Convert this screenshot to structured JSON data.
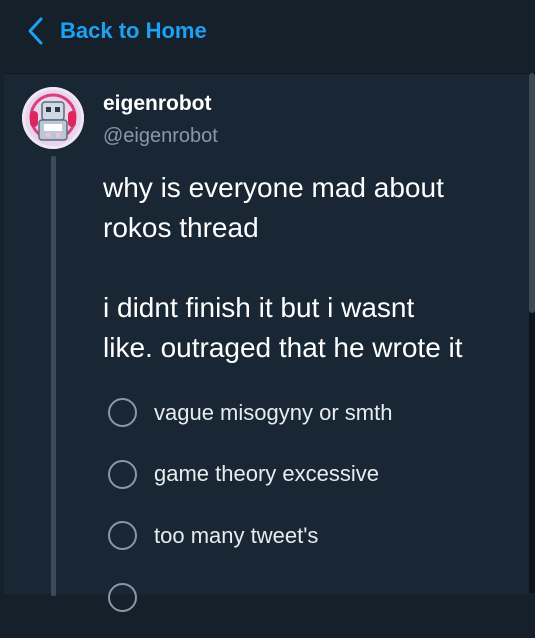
{
  "header": {
    "back_label": "Back to Home",
    "accent_color": "#1da1f2"
  },
  "tweet": {
    "display_name": "eigenrobot",
    "handle": "@eigenrobot",
    "text_lines": [
      "why is everyone mad about",
      "rokos thread",
      "i didnt finish it but i wasnt",
      "like. outraged that he wrote it"
    ],
    "poll": {
      "options": [
        "vague misogyny or smth",
        "game theory excessive",
        "too many tweet's",
        ""
      ]
    }
  },
  "icons": {
    "back": "chevron-left-icon",
    "avatar": "robot-avatar-image"
  },
  "theme": {
    "background": "#15202b",
    "panel": "#192734",
    "secondary_text": "#8899a6"
  }
}
